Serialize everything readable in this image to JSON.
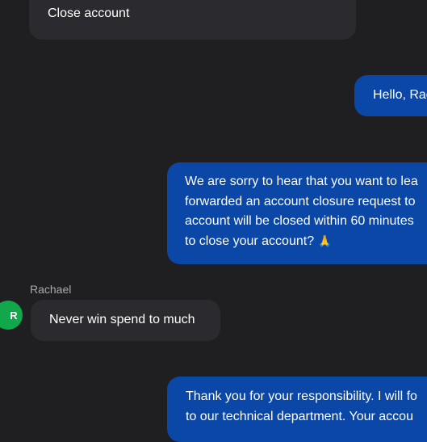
{
  "conversation": {
    "user_message_1": "Close account",
    "agent_greeting": "Hello, Rac",
    "agent_message_1": {
      "lines": [
        "We are sorry to hear that you want to lea",
        "forwarded an account closure request to",
        "account will be closed within 60 minutes",
        "to close your account?"
      ],
      "emoji": "🙏"
    },
    "user": {
      "name": "Rachael",
      "avatar_initial": "R",
      "avatar_color": "#10a84a"
    },
    "user_message_2": "Never win spend to much",
    "agent_message_2": {
      "lines": [
        "Thank you for your responsibility. I will fo",
        "to our technical department. Your accou"
      ]
    }
  },
  "colors": {
    "background": "#1f1f21",
    "user_bubble": "#2b2b2f",
    "agent_bubble": "#0a47a6"
  }
}
